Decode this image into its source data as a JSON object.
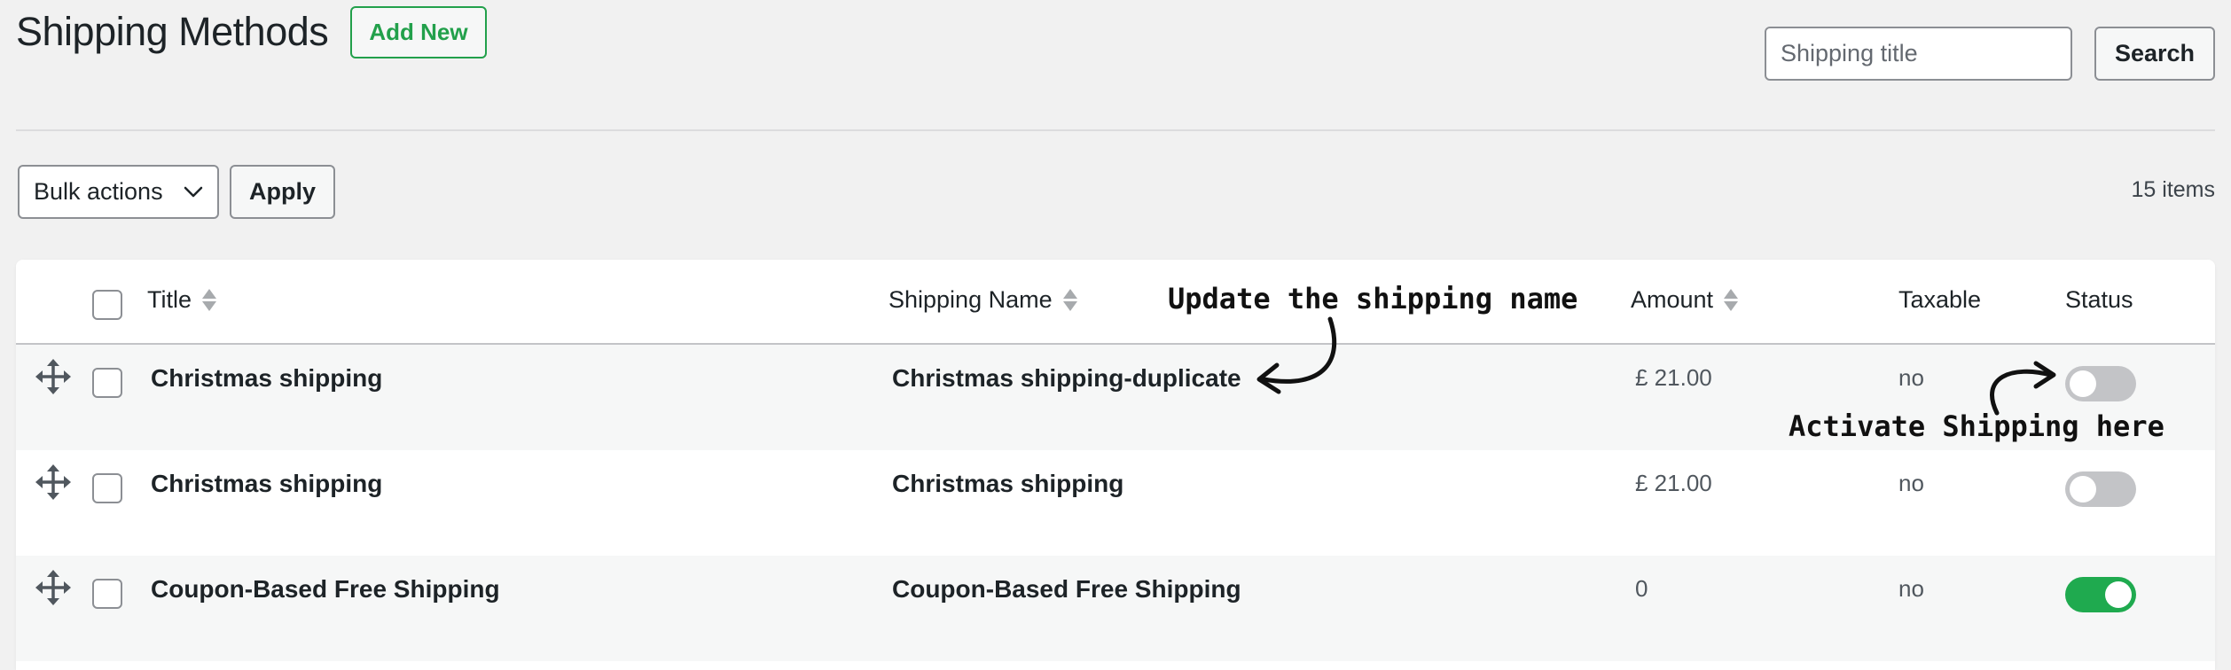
{
  "header": {
    "title": "Shipping Methods",
    "add_new_label": "Add New",
    "search_placeholder": "Shipping title",
    "search_button_label": "Search"
  },
  "toolbar": {
    "bulk_actions_label": "Bulk actions",
    "apply_label": "Apply",
    "items_count": "15 items"
  },
  "table": {
    "columns": {
      "title": "Title",
      "shipping_name": "Shipping Name",
      "amount": "Amount",
      "taxable": "Taxable",
      "status": "Status"
    },
    "rows": [
      {
        "title": "Christmas shipping",
        "shipping_name": "Christmas shipping-duplicate",
        "amount": "£ 21.00",
        "taxable": "no",
        "status_on": false
      },
      {
        "title": "Christmas shipping",
        "shipping_name": "Christmas shipping",
        "amount": "£ 21.00",
        "taxable": "no",
        "status_on": false
      },
      {
        "title": "Coupon-Based Free Shipping",
        "shipping_name": "Coupon-Based Free Shipping",
        "amount": "0",
        "taxable": "no",
        "status_on": true
      }
    ]
  },
  "annotations": {
    "update_name": "Update the shipping name",
    "activate": "Activate Shipping here"
  },
  "colors": {
    "accent_green": "#22a04b",
    "toggle_on": "#1faa4f",
    "toggle_off": "#c3c4c7"
  }
}
